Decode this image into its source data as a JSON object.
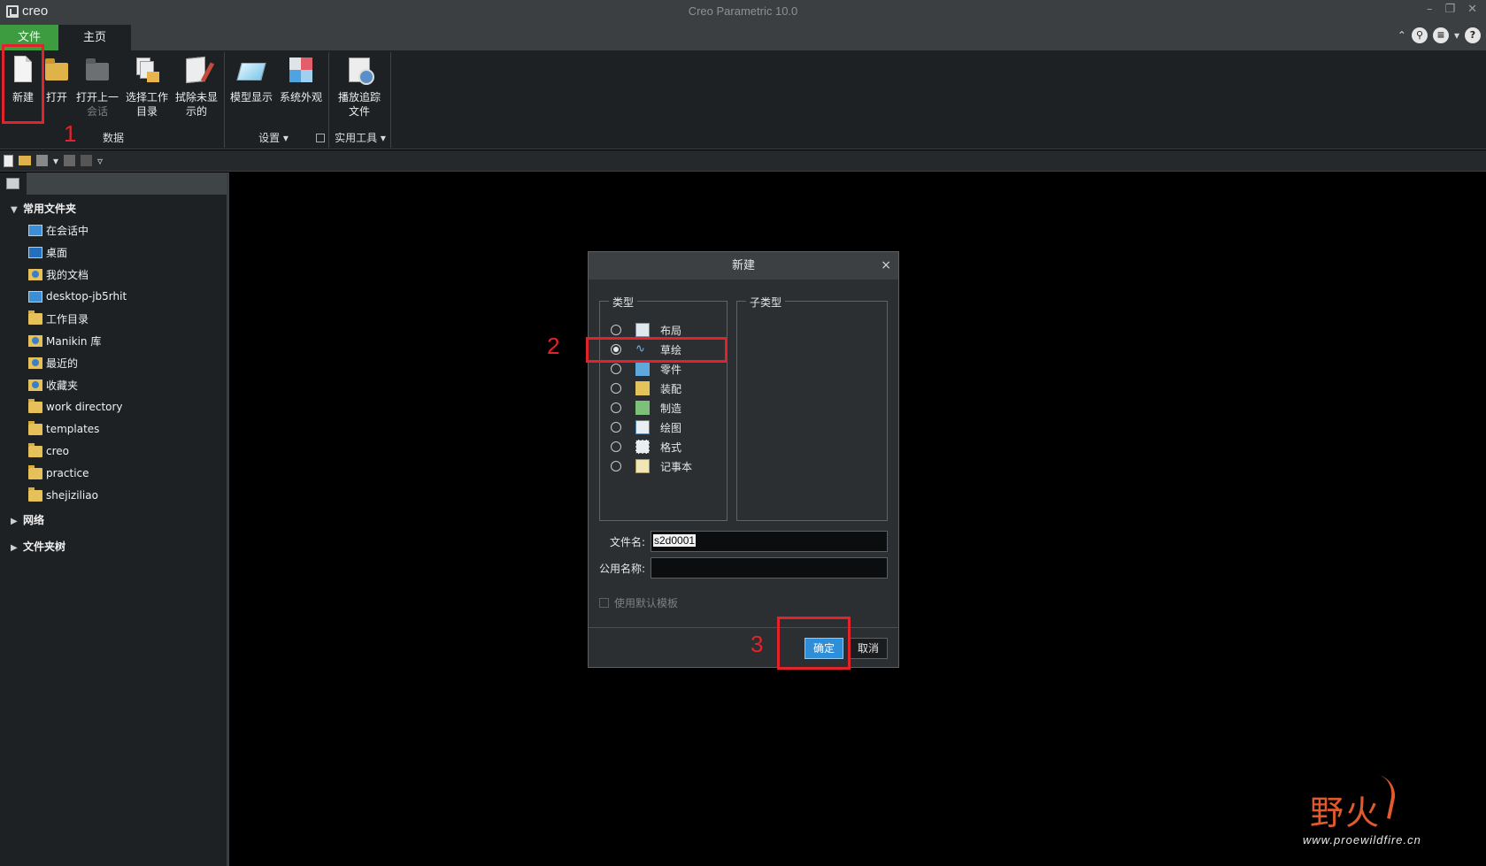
{
  "app": {
    "logo": "creo",
    "title": "Creo Parametric 10.0",
    "window_controls": [
      "–",
      "❐",
      "✕"
    ]
  },
  "tabs": {
    "file": "文件",
    "home": "主页"
  },
  "ribbon": {
    "buttons": [
      {
        "label1": "新建",
        "label2": ""
      },
      {
        "label1": "打开",
        "label2": ""
      },
      {
        "label1": "打开上一",
        "label2": "会话"
      },
      {
        "label1": "选择工作",
        "label2": "目录"
      },
      {
        "label1": "拭除未显",
        "label2": "示的"
      },
      {
        "label1": "模型显示",
        "label2": ""
      },
      {
        "label1": "系统外观",
        "label2": ""
      },
      {
        "label1": "播放追踪",
        "label2": "文件"
      }
    ],
    "groups": {
      "data": "数据",
      "settings": "设置",
      "utilities": "实用工具"
    }
  },
  "annotations": {
    "n1": "1",
    "n2": "2",
    "n3": "3"
  },
  "sidebar": {
    "common_folders": "常用文件夹",
    "items": [
      "在会话中",
      "桌面",
      "我的文档",
      "desktop-jb5rhit",
      "工作目录",
      "Manikin 库",
      "最近的",
      "收藏夹",
      "work directory",
      "templates",
      "creo",
      "practice",
      "shejiziliao"
    ],
    "network": "网络",
    "folder_tree": "文件夹树"
  },
  "dialog": {
    "title": "新建",
    "type_legend": "类型",
    "subtype_legend": "子类型",
    "types": [
      "布局",
      "草绘",
      "零件",
      "装配",
      "制造",
      "绘图",
      "格式",
      "记事本"
    ],
    "selected_type": "草绘",
    "filename_label": "文件名:",
    "filename_value": "s2d0001",
    "common_name_label": "公用名称:",
    "common_name_value": "",
    "use_default_template": "使用默认模板",
    "ok": "确定",
    "cancel": "取消"
  },
  "watermark": {
    "cn": "野火",
    "url": "www.proewildfire.cn"
  }
}
